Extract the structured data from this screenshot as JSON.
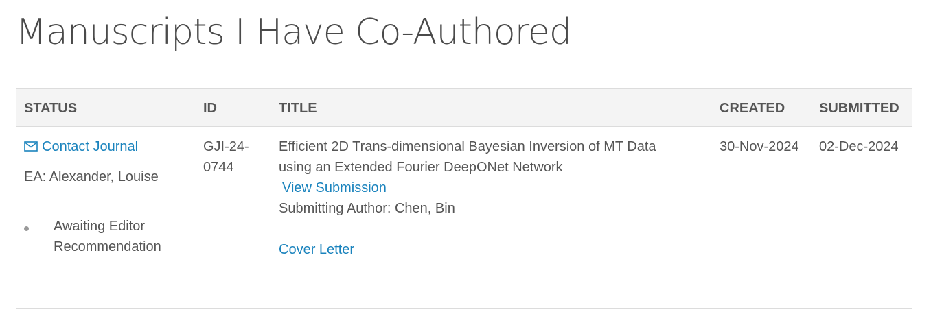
{
  "page": {
    "title": "Manuscripts I Have Co-Authored"
  },
  "table": {
    "headers": {
      "status": "STATUS",
      "id": "ID",
      "title": "TITLE",
      "created": "CREATED",
      "submitted": "SUBMITTED"
    },
    "rows": [
      {
        "contact_label": "Contact Journal",
        "contact_icon": "envelope-icon",
        "editor": "EA: Alexander, Louise",
        "status_line1": "Awaiting Editor",
        "status_line2": "Recommendation",
        "id_line1": "GJI-24-",
        "id_line2": "0744",
        "title_line1": "Efficient 2D Trans-dimensional Bayesian Inversion of MT Data",
        "title_line2": "using an Extended Fourier DeepONet Network",
        "view_submission": "View Submission",
        "submitting_author": "Submitting Author: Chen, Bin",
        "cover_letter": "Cover Letter",
        "created": "30-Nov-2024",
        "submitted": "02-Dec-2024"
      }
    ]
  },
  "colors": {
    "link": "#1a83bd",
    "text": "#555555",
    "header_bg": "#f4f4f4"
  }
}
